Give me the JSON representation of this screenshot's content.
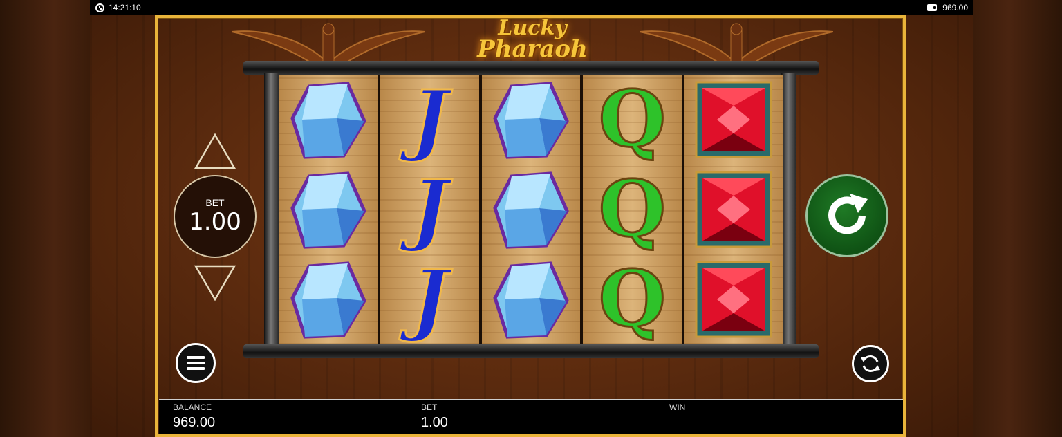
{
  "status_bar": {
    "time": "14:21:10",
    "balance": "969.00"
  },
  "game": {
    "title_line1": "Lucky",
    "title_line2": "Pharaoh",
    "reels": [
      [
        "blue-crystal",
        "blue-crystal",
        "blue-crystal"
      ],
      [
        "J",
        "J",
        "J"
      ],
      [
        "blue-crystal",
        "blue-crystal",
        "blue-crystal"
      ],
      [
        "Q",
        "Q",
        "Q"
      ],
      [
        "red-gem",
        "red-gem",
        "red-gem"
      ]
    ]
  },
  "bet_control": {
    "label": "BET",
    "value": "1.00"
  },
  "info_bar": {
    "balance_label": "BALANCE",
    "balance_value": "969.00",
    "bet_label": "BET",
    "bet_value": "1.00",
    "win_label": "WIN",
    "win_value": ""
  },
  "colors": {
    "frame_gold": "#e9b43a",
    "spin_green": "#0f5214",
    "j_blue": "#1a2bd0",
    "q_green": "#2ec22a",
    "gem_red": "#e0102a",
    "crystal_blue": "#7ec8f0"
  }
}
